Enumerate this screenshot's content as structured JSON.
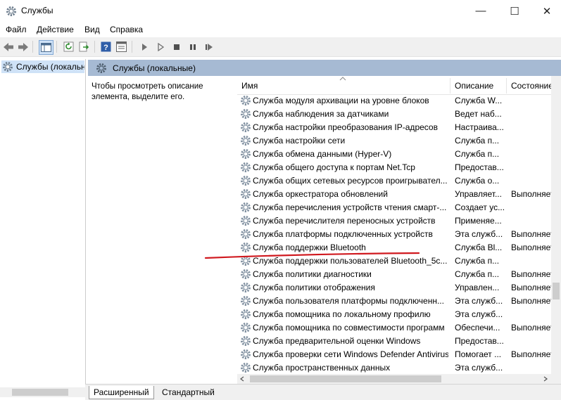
{
  "window": {
    "title": "Службы",
    "min": "—",
    "max": "☐",
    "close": "✕"
  },
  "menu": [
    "Файл",
    "Действие",
    "Вид",
    "Справка"
  ],
  "tree": {
    "item": "Службы (локальные)"
  },
  "header": {
    "title": "Службы (локальные)"
  },
  "description": "Чтобы просмотреть описание элемента, выделите его.",
  "columns": {
    "name": "Имя",
    "desc": "Описание",
    "status": "Состояние"
  },
  "rows": [
    {
      "name": "Служба модуля архивации на уровне блоков",
      "desc": "Служба W...",
      "status": ""
    },
    {
      "name": "Служба наблюдения за датчиками",
      "desc": "Ведет наб...",
      "status": ""
    },
    {
      "name": "Служба настройки преобразования IP-адресов",
      "desc": "Настраива...",
      "status": ""
    },
    {
      "name": "Служба настройки сети",
      "desc": "Служба п...",
      "status": ""
    },
    {
      "name": "Служба обмена данными (Hyper-V)",
      "desc": "Служба п...",
      "status": ""
    },
    {
      "name": "Служба общего доступа к портам Net.Tcp",
      "desc": "Предостав...",
      "status": ""
    },
    {
      "name": "Служба общих сетевых ресурсов проигрывател...",
      "desc": "Служба о...",
      "status": ""
    },
    {
      "name": "Служба оркестратора обновлений",
      "desc": "Управляет...",
      "status": "Выполняется"
    },
    {
      "name": "Служба перечисления устройств чтения смарт-...",
      "desc": "Создает ус...",
      "status": ""
    },
    {
      "name": "Служба перечислителя переносных устройств",
      "desc": "Применяе...",
      "status": ""
    },
    {
      "name": "Служба платформы подключенных устройств",
      "desc": "Эта служб...",
      "status": "Выполняется"
    },
    {
      "name": "Служба поддержки Bluetooth",
      "desc": "Служба Bl...",
      "status": "Выполняется"
    },
    {
      "name": "Служба поддержки пользователей Bluetooth_5c...",
      "desc": "Служба п...",
      "status": ""
    },
    {
      "name": "Служба политики диагностики",
      "desc": "Служба п...",
      "status": "Выполняется"
    },
    {
      "name": "Служба политики отображения",
      "desc": "Управлен...",
      "status": "Выполняется"
    },
    {
      "name": "Служба пользователя платформы подключенн...",
      "desc": "Эта служб...",
      "status": "Выполняется"
    },
    {
      "name": "Служба помощника по локальному профилю",
      "desc": "Эта служб...",
      "status": ""
    },
    {
      "name": "Служба помощника по совместимости программ",
      "desc": "Обеспечи...",
      "status": "Выполняется"
    },
    {
      "name": "Служба предварительной оценки Windows",
      "desc": "Предостав...",
      "status": ""
    },
    {
      "name": "Служба проверки сети Windows Defender Antivirus",
      "desc": "Помогает ...",
      "status": "Выполняется"
    },
    {
      "name": "Служба пространственных данных",
      "desc": "Эта служб...",
      "status": ""
    }
  ],
  "tabs": {
    "extended": "Расширенный",
    "standard": "Стандартный"
  },
  "colors": {
    "header_band": "#a6bad3",
    "tree_selected": "#cfe2f7",
    "annotation": "#d0191f"
  }
}
